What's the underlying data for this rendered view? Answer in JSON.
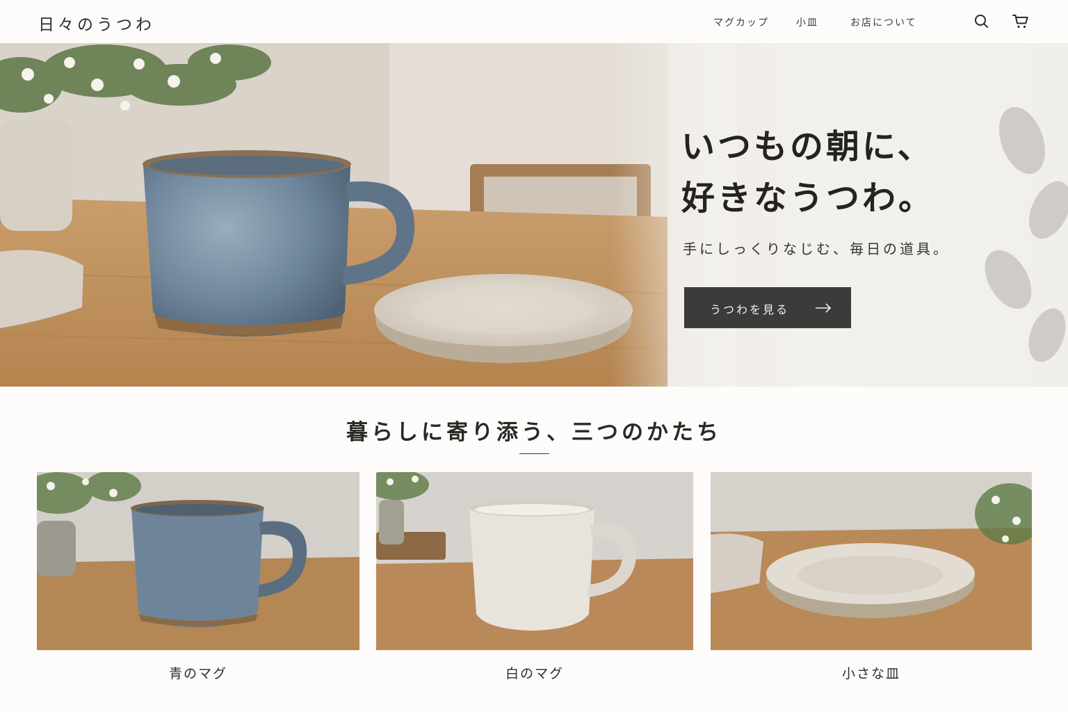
{
  "header": {
    "logo": "日々のうつわ",
    "nav": [
      {
        "label": "マグカップ"
      },
      {
        "label": "小皿"
      },
      {
        "label": "お店について"
      }
    ],
    "icons": {
      "search": "search-icon",
      "cart": "cart-icon"
    }
  },
  "hero": {
    "title_line1": "いつもの朝に、",
    "title_line2": "好きなうつわ。",
    "subtitle": "手にしっくりなじむ、毎日の道具。",
    "button_label": "うつわを見る",
    "button_icon": "arrow-right-icon"
  },
  "section": {
    "title": "暮らしに寄り添う、三つのかたち"
  },
  "products": [
    {
      "label": "青のマグ"
    },
    {
      "label": "白のマグ"
    },
    {
      "label": "小さな皿"
    }
  ],
  "colors": {
    "button_bg": "#3b3b3a",
    "page_bg": "#fdfcfa",
    "text": "#2b2926"
  }
}
